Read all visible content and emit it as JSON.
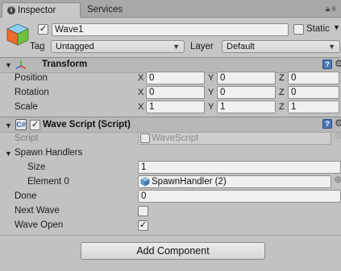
{
  "tabs": {
    "inspector_label": "Inspector",
    "services_label": "Services"
  },
  "gameobject": {
    "name": "Wave1",
    "active": true,
    "static_label": "Static",
    "tag_label": "Tag",
    "tag_value": "Untagged",
    "layer_label": "Layer",
    "layer_value": "Default"
  },
  "transform": {
    "title": "Transform",
    "rows": [
      {
        "label": "Position",
        "x": "0",
        "y": "0",
        "z": "0"
      },
      {
        "label": "Rotation",
        "x": "0",
        "y": "0",
        "z": "0"
      },
      {
        "label": "Scale",
        "x": "1",
        "y": "1",
        "z": "1"
      }
    ],
    "axis_x": "X",
    "axis_y": "Y",
    "axis_z": "Z"
  },
  "wave_script": {
    "title": "Wave Script (Script)",
    "enabled": true,
    "script_label": "Script",
    "script_value": "WaveScript",
    "spawn_handlers_label": "Spawn Handlers",
    "size_label": "Size",
    "size_value": "1",
    "element0_label": "Element 0",
    "element0_value": "SpawnHandler (2)",
    "done_label": "Done",
    "done_value": "0",
    "next_wave_label": "Next Wave",
    "next_wave_checked": false,
    "wave_open_label": "Wave Open",
    "wave_open_checked": true
  },
  "add_component_label": "Add Component",
  "colors": {
    "panel_bg": "#c2c2c2",
    "header_bg": "#b8b8b8",
    "help_blue": "#4a78b8"
  }
}
